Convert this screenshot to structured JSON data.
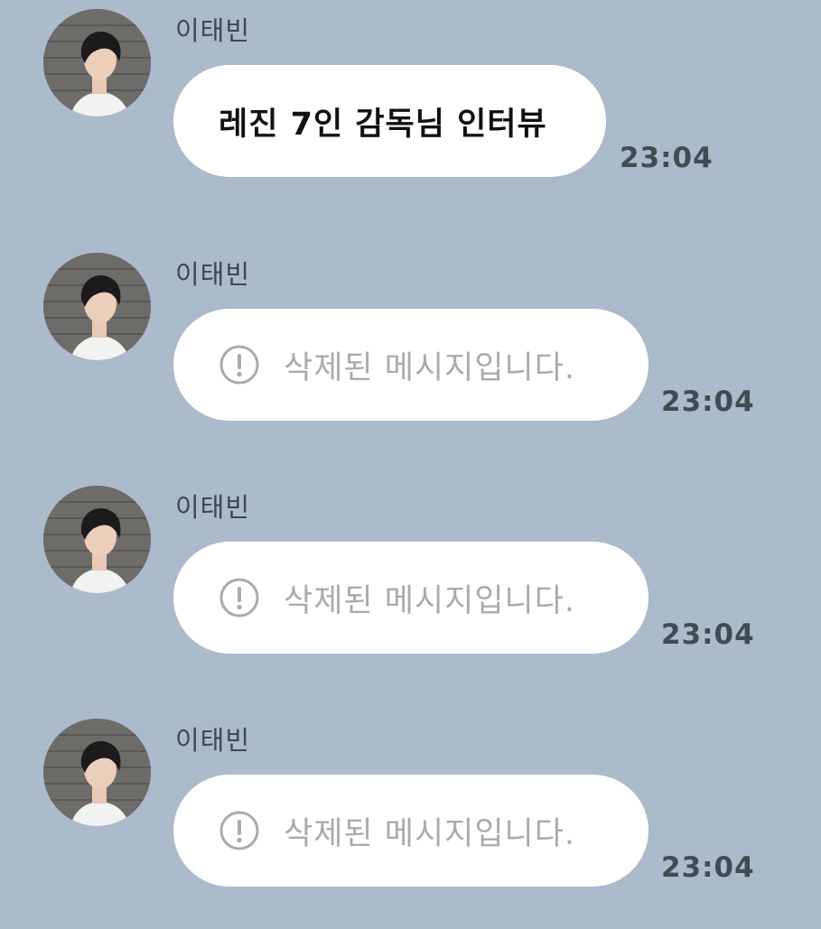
{
  "messages": [
    {
      "sender": "이태빈",
      "type": "text",
      "text": "레진 7인 감독님 인터뷰",
      "time": "23:04",
      "avatar_icon": "profile-photo"
    },
    {
      "sender": "이태빈",
      "type": "deleted",
      "text": "삭제된 메시지입니다.",
      "time": "23:04",
      "icon": "exclamation-circle-icon",
      "avatar_icon": "profile-photo"
    },
    {
      "sender": "이태빈",
      "type": "deleted",
      "text": "삭제된 메시지입니다.",
      "time": "23:04",
      "icon": "exclamation-circle-icon",
      "avatar_icon": "profile-photo"
    },
    {
      "sender": "이태빈",
      "type": "deleted",
      "text": "삭제된 메시지입니다.",
      "time": "23:04",
      "icon": "exclamation-circle-icon",
      "avatar_icon": "profile-photo"
    }
  ],
  "colors": {
    "background": "#abbbcc",
    "bubble": "#ffffff",
    "sender_text": "#3f4750",
    "message_text": "#111111",
    "deleted_text": "#a9abb0",
    "time_text": "#424a52"
  }
}
